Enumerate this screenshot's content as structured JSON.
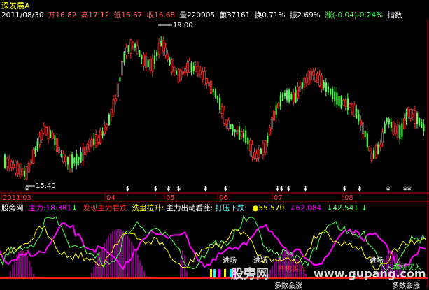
{
  "title": "深发展A",
  "info": {
    "date": "2011/08/30",
    "open_label": "开",
    "open": "16.82",
    "high_label": "高",
    "high": "17.12",
    "low_label": "低",
    "low": "16.67",
    "close_label": "收",
    "close": "16.68",
    "volume_label": "量",
    "volume": "220005",
    "amount_label": "额",
    "amount": "37161",
    "turnover_label": "换",
    "turnover": "0.71%",
    "amplitude_label": "振",
    "amplitude": "2.69%",
    "change_label": "涨",
    "change": "(-0.04)-0.24%",
    "next_label": "指数"
  },
  "price_chart": {
    "high_mark": "19.00",
    "low_mark": "15.40",
    "x_labels": [
      "2011",
      "03",
      "04",
      "05",
      "06",
      "07",
      "08"
    ]
  },
  "indicator": {
    "name": "股旁网",
    "zhuli_label": "主力",
    "zhuli_value": "18.381",
    "zhuli_arrow": "↓",
    "discover_label": "发现主力看跌",
    "wash_label": "洗盘拉升:",
    "out_label": "主力出动看涨:",
    "press_label": "打压下跌:",
    "v1": "55.570",
    "v2": "62.084",
    "v3": "42.541",
    "annotations": {
      "enter1": "进场",
      "enter2": "进场",
      "enter3": "进场",
      "bottom1": "多数会涨",
      "bottom2": "多数会涨",
      "buy1": "择机买入",
      "buy2": "择机买入"
    }
  },
  "watermark": {
    "text1": "股旁网",
    "text2": "www.gupang.com"
  },
  "colors": {
    "up": "#ff3232",
    "down": "#54ff54",
    "yellow": "#ffff00",
    "magenta": "#ff00ff",
    "white": "#ffffff",
    "cyan": "#00ffff",
    "frame": "#b00000"
  }
}
